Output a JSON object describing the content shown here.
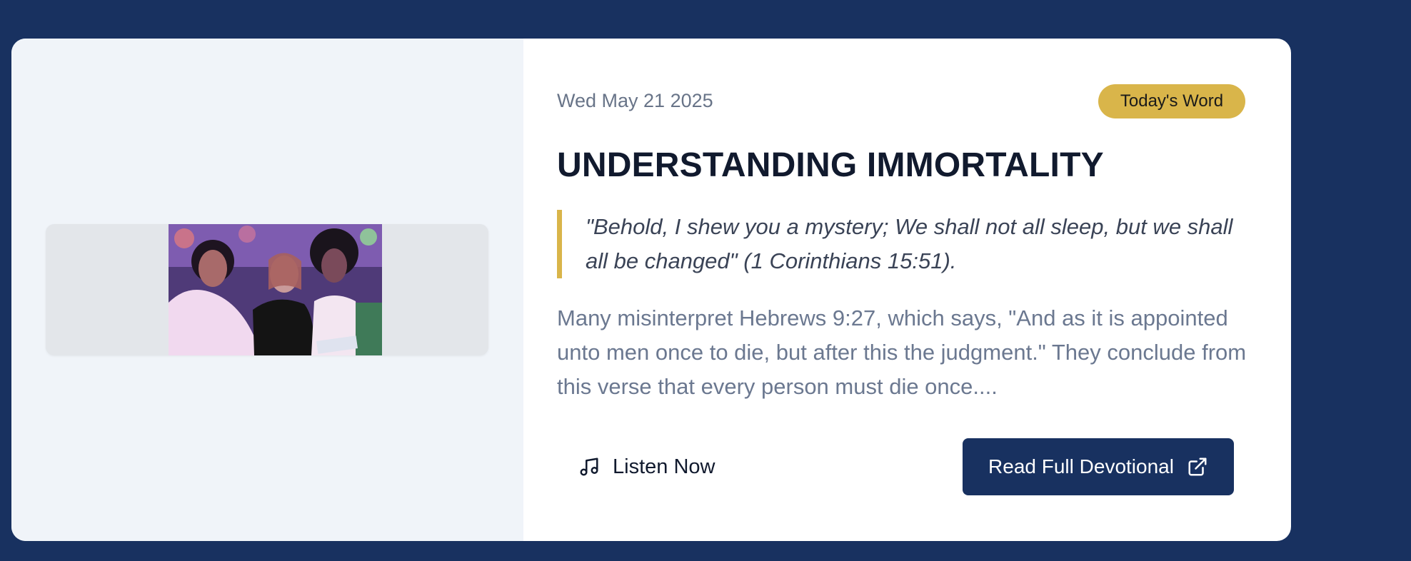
{
  "devotional": {
    "date": "Wed May 21 2025",
    "badge": "Today's Word",
    "title": "UNDERSTANDING IMMORTALITY",
    "quote": "\"Behold, I shew you a mystery; We shall not all sleep, but we shall all be changed\" (1 Corinthians 15:51).",
    "excerpt": "Many misinterpret Hebrews 9:27, which says, \"And as it is appointed unto men once to die, but after this the judgment.\" They conclude from this verse that every person must die once....",
    "listen_label": "Listen Now",
    "read_label": "Read Full Devotional"
  },
  "icons": {
    "listen": "music-note-icon",
    "read": "external-link-icon"
  },
  "colors": {
    "page_background": "#183160",
    "accent": "#d9b54a",
    "primary_button": "#183160"
  }
}
